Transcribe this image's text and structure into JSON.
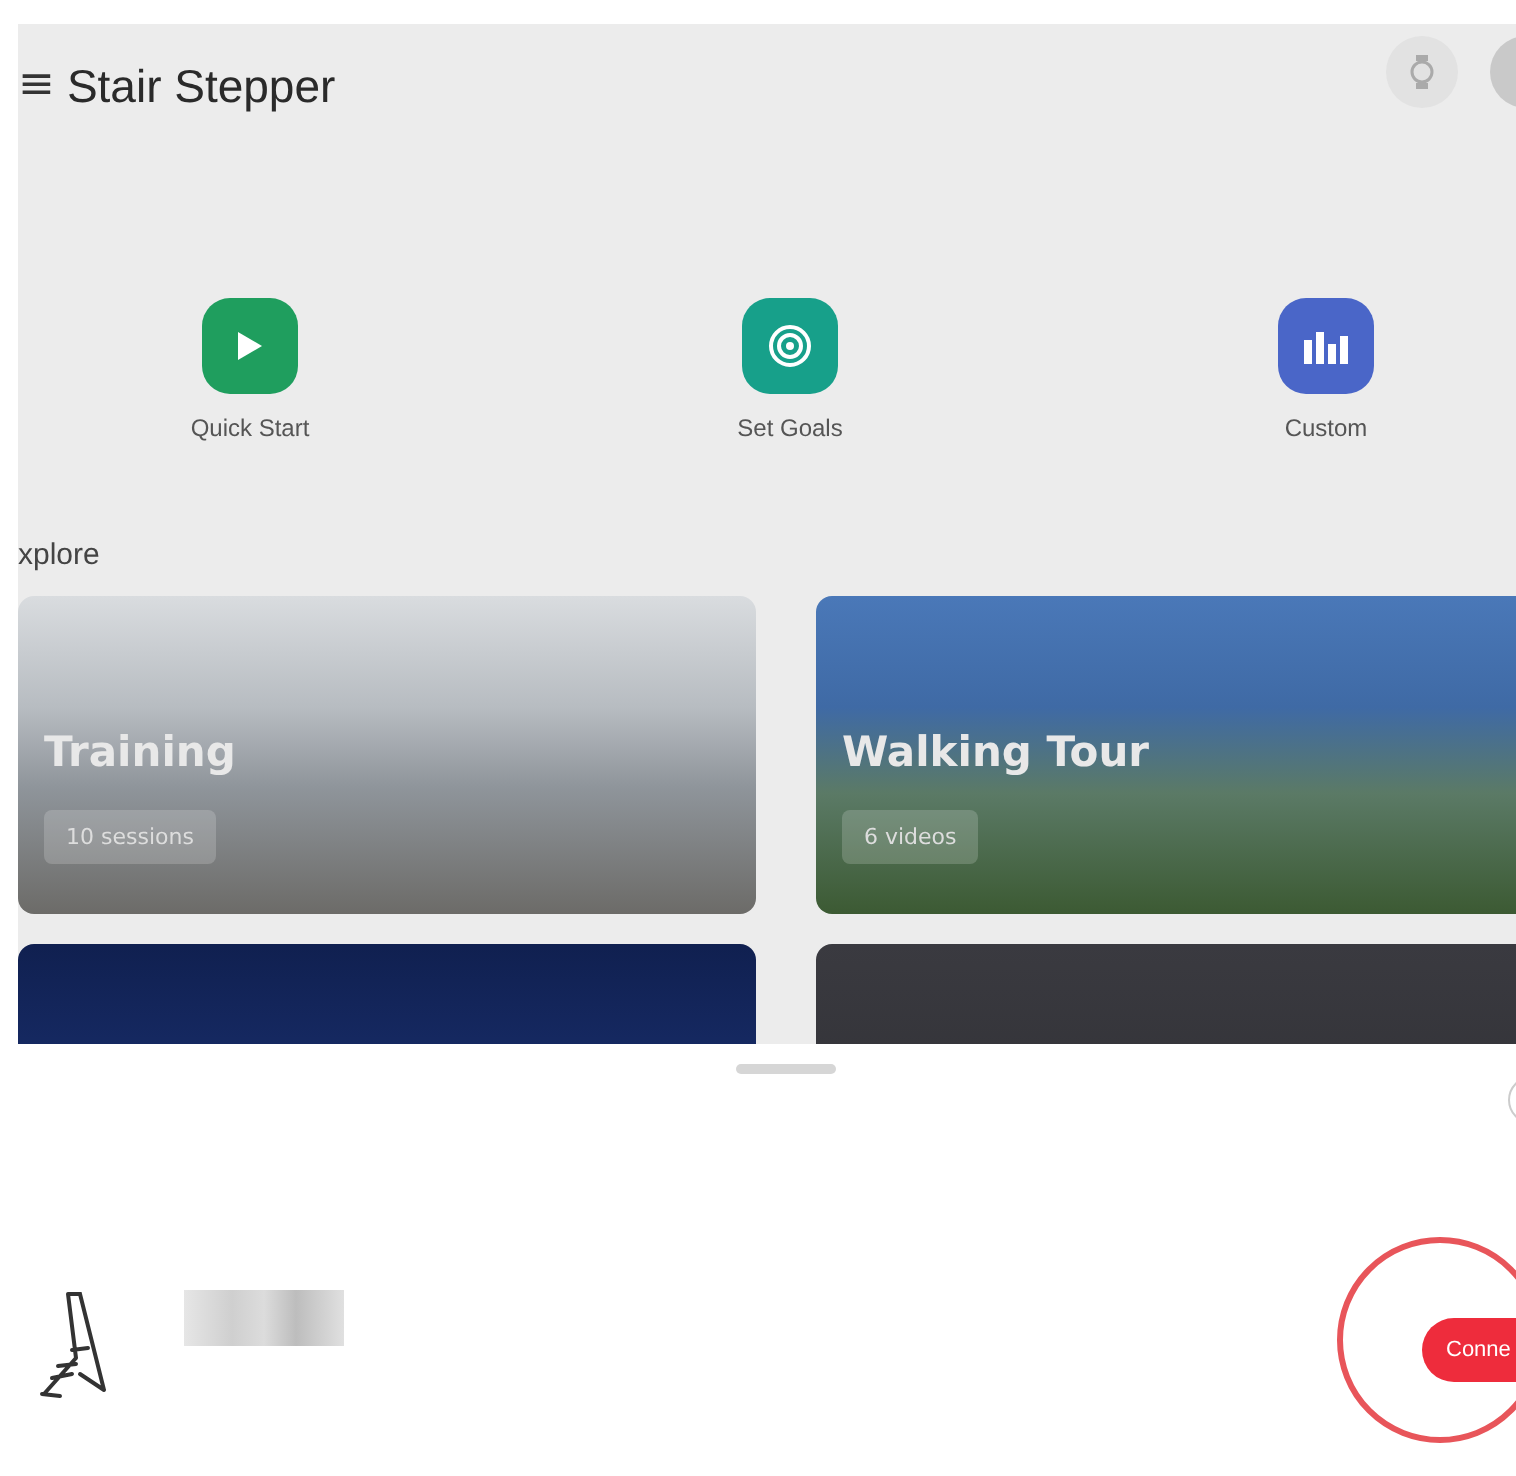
{
  "header": {
    "menu_glyph": "≡",
    "title": "Stair Stepper"
  },
  "quick_actions": [
    {
      "kind": "play",
      "label": "Quick Start",
      "color": "#1f9e5e"
    },
    {
      "kind": "target",
      "label": "Set Goals",
      "color": "#17a08a"
    },
    {
      "kind": "bars",
      "label": "Custom",
      "color": "#4a66c8"
    }
  ],
  "explore": {
    "heading": "xplore",
    "cards": [
      {
        "kind": "mountain-climb",
        "title": "Training",
        "badge": "10 sessions"
      },
      {
        "kind": "mountain-valley",
        "title": "Walking Tour",
        "badge": "6 videos"
      },
      {
        "kind": "night"
      },
      {
        "kind": "dark"
      }
    ]
  },
  "device_sheet": {
    "connect_button": "Conne"
  }
}
